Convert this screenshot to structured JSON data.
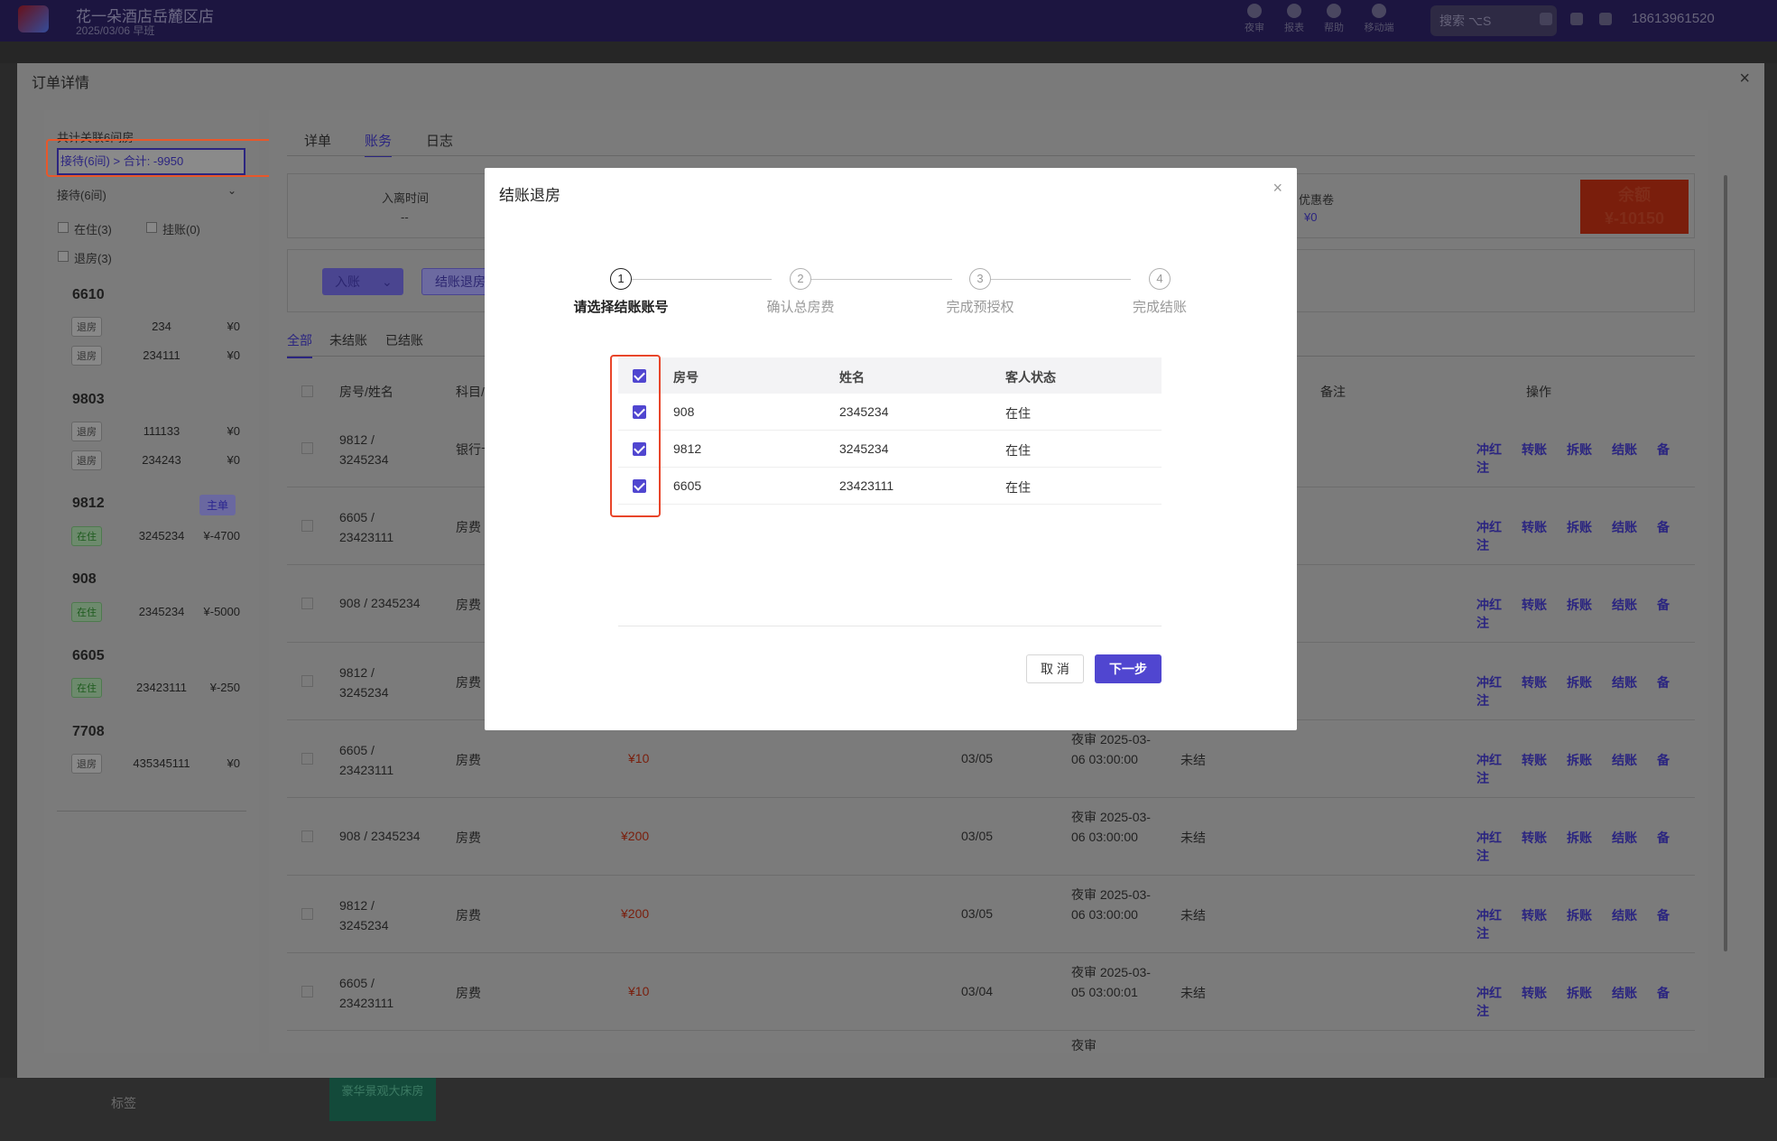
{
  "topbar": {
    "hotel_name": "花一朵酒店岳麓区店",
    "hotel_sub": "2025/03/06  早班",
    "tools": [
      "夜审",
      "报表",
      "帮助",
      "移动端"
    ],
    "search_placeholder": "搜索",
    "search_shortcut": "⌥S",
    "user": "18613961520"
  },
  "background": {
    "tag_label": "标签",
    "room_type": "豪华景观大床房"
  },
  "drawer": {
    "title": "订单详情",
    "close": "×",
    "left": {
      "summary": "共计关联6间房",
      "selector": "接待(6间) > 合计: -9950",
      "group": "接待(6间)",
      "filters": {
        "live": "在住(3)",
        "hang": "挂账(0)",
        "out": "退房(3)"
      },
      "main_flag": "主单",
      "rooms": [
        {
          "no": "6610",
          "guests": [
            {
              "status": "退房",
              "name": "234",
              "amount": "¥0"
            },
            {
              "status": "退房",
              "name": "234111",
              "amount": "¥0"
            }
          ]
        },
        {
          "no": "9803",
          "guests": [
            {
              "status": "退房",
              "name": "111133",
              "amount": "¥0"
            },
            {
              "status": "退房",
              "name": "234243",
              "amount": "¥0"
            }
          ]
        },
        {
          "no": "9812",
          "guests": [
            {
              "status": "在住",
              "name": "3245234",
              "amount": "¥-4700"
            }
          ]
        },
        {
          "no": "908",
          "guests": [
            {
              "status": "在住",
              "name": "2345234",
              "amount": "¥-5000"
            }
          ]
        },
        {
          "no": "6605",
          "guests": [
            {
              "status": "在住",
              "name": "23423111",
              "amount": "¥-250"
            }
          ]
        },
        {
          "no": "7708",
          "guests": [
            {
              "status": "退房",
              "name": "435345111",
              "amount": "¥0"
            }
          ]
        }
      ]
    },
    "right": {
      "tabs": [
        "详单",
        "账务",
        "日志"
      ],
      "summary": {
        "time_label": "入离时间",
        "time_value": "--",
        "coupon_label": "优惠卷",
        "coupon_value": "¥0",
        "balance_label": "余额",
        "balance_value": "¥-10150"
      },
      "buttons": {
        "entry": "入账",
        "checkout": "结账退房"
      },
      "subtabs": [
        "全部",
        "未结账",
        "已结账"
      ],
      "columns": {
        "room": "房号/姓名",
        "item": "科目/",
        "remark": "备注",
        "ops": "操作"
      },
      "ops": [
        "冲红",
        "转账",
        "拆账",
        "结账",
        "备注"
      ],
      "rows": [
        {
          "room": "9812 / 3245234",
          "item": "银行卡",
          "amount": "",
          "date": "",
          "audit": "",
          "status": ""
        },
        {
          "room": "6605 / 23423111",
          "item": "房费",
          "amount": "",
          "date": "",
          "audit": "",
          "status": ""
        },
        {
          "room": "908 / 2345234",
          "item": "房费",
          "amount": "",
          "date": "",
          "audit": "",
          "status": ""
        },
        {
          "room": "9812 / 3245234",
          "item": "房费",
          "amount": "",
          "date": "",
          "audit": "",
          "status": ""
        },
        {
          "room": "6605 / 23423111",
          "item": "房费",
          "amount": "¥10",
          "date": "03/05",
          "audit": "夜审 2025-03-06 03:00:00",
          "status": "未结"
        },
        {
          "room": "908 / 2345234",
          "item": "房费",
          "amount": "¥200",
          "date": "03/05",
          "audit": "夜审 2025-03-06 03:00:00",
          "status": "未结"
        },
        {
          "room": "9812 / 3245234",
          "item": "房费",
          "amount": "¥200",
          "date": "03/05",
          "audit": "夜审 2025-03-06 03:00:00",
          "status": "未结"
        },
        {
          "room": "6605 / 23423111",
          "item": "房费",
          "amount": "¥10",
          "date": "03/04",
          "audit": "夜审 2025-03-05 03:00:01",
          "status": "未结"
        }
      ],
      "partial_audit": "夜审"
    }
  },
  "modal": {
    "title": "结账退房",
    "close": "×",
    "steps": [
      {
        "num": "1",
        "label": "请选择结账账号"
      },
      {
        "num": "2",
        "label": "确认总房费"
      },
      {
        "num": "3",
        "label": "完成预授权"
      },
      {
        "num": "4",
        "label": "完成结账"
      }
    ],
    "table": {
      "headers": {
        "room": "房号",
        "name": "姓名",
        "status": "客人状态"
      },
      "rows": [
        {
          "room": "908",
          "name": "2345234",
          "status": "在住"
        },
        {
          "room": "9812",
          "name": "3245234",
          "status": "在住"
        },
        {
          "room": "6605",
          "name": "23423111",
          "status": "在住"
        }
      ]
    },
    "cancel": "取 消",
    "next": "下一步"
  }
}
